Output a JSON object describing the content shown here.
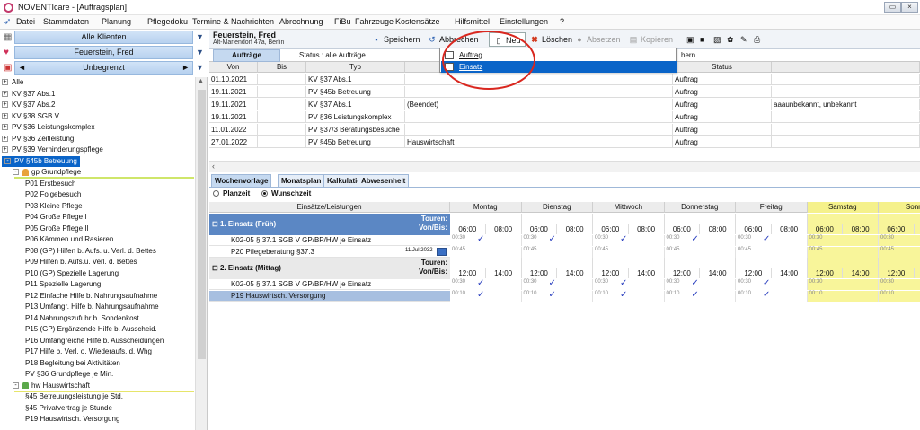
{
  "window": {
    "title": "NOVENTIcare - [Auftragsplan]"
  },
  "menu": [
    "Datei",
    "Stammdaten",
    "Planung",
    "Pflegedoku",
    "Termine & Nachrichten",
    "Abrechnung",
    "FiBu",
    "Fahrzeuge",
    "Kostensätze",
    "Hilfsmittel",
    "Einstellungen",
    "?"
  ],
  "left": {
    "client_filter": "Alle Klienten",
    "client": "Feuerstein, Fred",
    "period": "Unbegrenzt",
    "tree": [
      {
        "label": "Alle",
        "level": 0,
        "pm": "+"
      },
      {
        "label": "KV §37 Abs.1",
        "level": 0,
        "pm": "+"
      },
      {
        "label": "KV §37 Abs.2",
        "level": 0,
        "pm": "+"
      },
      {
        "label": "KV §38 SGB V",
        "level": 0,
        "pm": "+"
      },
      {
        "label": "PV §36 Leistungskomplex",
        "level": 0,
        "pm": "+"
      },
      {
        "label": "PV §36 Zeitleistung",
        "level": 0,
        "pm": "+"
      },
      {
        "label": "PV §39 Verhinderungspflege",
        "level": 0,
        "pm": "+"
      },
      {
        "label": "PV §45b Betreuung",
        "level": 0,
        "pm": "-",
        "selected": true
      },
      {
        "label": "gp   Grundpflege",
        "level": 1,
        "pm": "-",
        "person": "#e8a23a"
      },
      {
        "label": "P01 Erstbesuch",
        "level": 2
      },
      {
        "label": "P02 Folgebesuch",
        "level": 2
      },
      {
        "label": "P03 Kleine Pflege",
        "level": 2
      },
      {
        "label": "P04 Große Pflege I",
        "level": 2
      },
      {
        "label": "P05 Große Pflege II",
        "level": 2
      },
      {
        "label": "P06 Kämmen und Rasieren",
        "level": 2
      },
      {
        "label": "P08 (GP) Hilfen b. Aufs. u. Verl. d. Bettes",
        "level": 2
      },
      {
        "label": "P09 Hilfen b. Aufs.u. Verl. d. Bettes",
        "level": 2
      },
      {
        "label": "P10 (GP) Spezielle Lagerung",
        "level": 2
      },
      {
        "label": "P11 Spezielle Lagerung",
        "level": 2
      },
      {
        "label": "P12 Einfache Hilfe b. Nahrungsaufnahme",
        "level": 2
      },
      {
        "label": "P13 Umfangr. Hilfe b. Nahrungsaufnahme",
        "level": 2
      },
      {
        "label": "P14 Nahrungszufuhr b. Sondenkost",
        "level": 2
      },
      {
        "label": "P15 (GP) Ergänzende Hilfe b. Ausscheid.",
        "level": 2
      },
      {
        "label": "P16 Umfangreiche Hilfe b. Ausscheidungen",
        "level": 2
      },
      {
        "label": "P17 Hilfe b. Verl. o. Wiederaufs. d. Whg",
        "level": 2
      },
      {
        "label": "P18 Begleitung bei Aktivitäten",
        "level": 2
      },
      {
        "label": "PV §36 Grundpflege je Min.",
        "level": 2
      },
      {
        "label": "hw   Hauswirtschaft",
        "level": 1,
        "pm": "-",
        "person": "#5ba84a"
      },
      {
        "label": "§45 Betreuungsleistung je Std.",
        "level": 2
      },
      {
        "label": "§45 Privatvertrag je Stunde",
        "level": 2
      },
      {
        "label": "P19 Hauswirtsch. Versorgung",
        "level": 2
      }
    ]
  },
  "header": {
    "patient_name": "Feuerstein, Fred",
    "patient_address": "Alt-Mariendorf 47a, Berlin",
    "buttons": {
      "save": "Speichern",
      "cancel": "Abbrechen",
      "new": "Neu",
      "delete": "Löschen",
      "dismiss": "Absetzen",
      "copy": "Kopieren"
    }
  },
  "orders": {
    "tab": "Aufträge",
    "status_label": "Status :  alle Aufträge",
    "status2_partial": "hern",
    "columns": {
      "von": "Von",
      "bis": "Bis",
      "typ": "Typ",
      "status": "Status"
    },
    "rows": [
      {
        "von": "01.10.2021",
        "bis": "",
        "typ": "KV §37 Abs.1",
        "desc": "",
        "status": "Auftrag",
        "note": ""
      },
      {
        "von": "19.11.2021",
        "bis": "",
        "typ": "PV §45b Betreuung",
        "desc": "",
        "status": "Auftrag",
        "note": ""
      },
      {
        "von": "19.11.2021",
        "bis": "",
        "typ": "KV §37 Abs.1",
        "desc": "(Beendet)",
        "status": "Auftrag",
        "note": "aaaunbekannt, unbekannt"
      },
      {
        "von": "19.11.2021",
        "bis": "",
        "typ": "PV §36 Leistungskomplex",
        "desc": "",
        "status": "Auftrag",
        "note": ""
      },
      {
        "von": "11.01.2022",
        "bis": "",
        "typ": "PV §37/3 Beratungsbesuche",
        "desc": "",
        "status": "Auftrag",
        "note": ""
      },
      {
        "von": "27.01.2022",
        "bis": "",
        "typ": "PV §45b Betreuung",
        "desc": "Hauswirtschaft",
        "status": "Auftrag",
        "note": ""
      }
    ]
  },
  "new_menu": {
    "items": [
      "Auftrag",
      "Einsatz"
    ],
    "active_index": 1
  },
  "plan": {
    "tabs": [
      "Wochenvorlage",
      "Monatsplan",
      "Kalkulation",
      "Abwesenheit"
    ],
    "radio_plan": "Planzeit",
    "radio_wish": "Wunschzeit",
    "col_title": "Einsätze/Leistungen",
    "days": [
      "Montag",
      "Dienstag",
      "Mittwoch",
      "Donnerstag",
      "Freitag",
      "Samstag",
      "Sonn"
    ],
    "touren": "Touren:",
    "vonbis": "Von/Bis:",
    "blocks": [
      {
        "title": "1. Einsatz (Früh)",
        "von": "06:00",
        "bis": "08:00",
        "services": [
          {
            "label": "K02-05 § 37.1 SGB V GP/BP/HW je Einsatz",
            "mini": "00:30",
            "checks": [
              true,
              true,
              true,
              true,
              true,
              false,
              false
            ],
            "highlight": false
          },
          {
            "label": "P20 Pflegeberatung §37.3",
            "date": "11.Jul.2032",
            "mini": "00:45",
            "checks": [
              false,
              false,
              false,
              false,
              false,
              false,
              false
            ],
            "highlight": false
          }
        ]
      },
      {
        "title": "2. Einsatz (Mittag)",
        "von": "12:00",
        "bis": "14:00",
        "services": [
          {
            "label": "K02-05 § 37.1 SGB V GP/BP/HW je Einsatz",
            "mini": "00:30",
            "checks": [
              true,
              true,
              true,
              true,
              true,
              false,
              false
            ],
            "highlight": false
          },
          {
            "label": "P19 Hauswirtsch. Versorgung",
            "mini": "00:10",
            "checks": [
              true,
              true,
              true,
              true,
              true,
              false,
              false
            ],
            "highlight": true
          }
        ]
      }
    ]
  },
  "colors": {
    "selection": "#0a64c8",
    "header_blue": "#c5d9f0",
    "weekend_yellow": "#f5f18b",
    "annotation_red": "#d9271f"
  }
}
